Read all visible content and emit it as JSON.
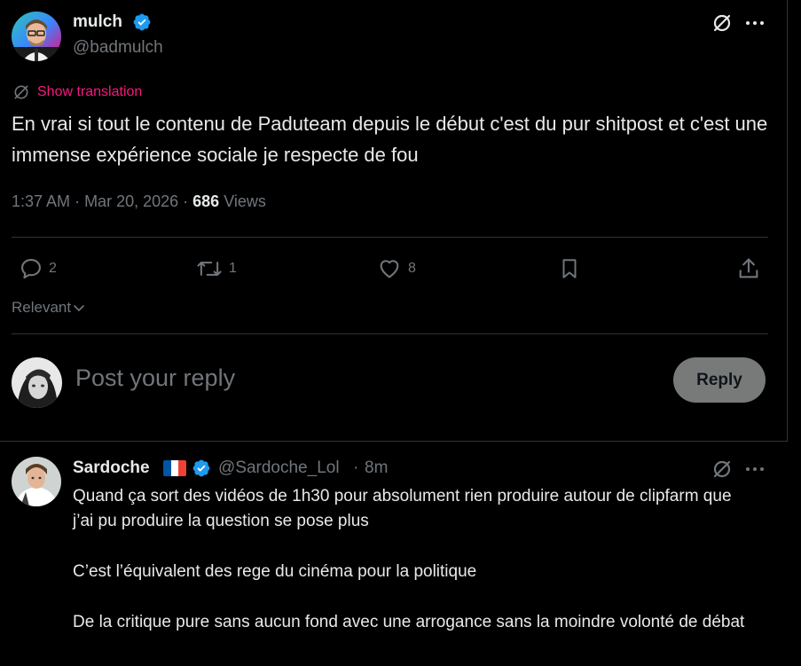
{
  "main_tweet": {
    "author": {
      "display_name": "mulch",
      "handle": "@badmulch"
    },
    "show_translation": "Show translation",
    "text": "En vrai si tout le contenu de Paduteam depuis le début c'est du pur shitpost et c'est une immense expérience sociale je respecte de fou",
    "time": "1:37 AM",
    "date": "Mar 20, 2026",
    "views_count": "686",
    "views_label": "Views",
    "actions": {
      "replies": "2",
      "reposts": "1",
      "likes": "8"
    }
  },
  "sort": {
    "label": "Relevant"
  },
  "composer": {
    "placeholder": "Post your reply",
    "reply_button": "Reply"
  },
  "reply": {
    "author": {
      "display_name": "Sardoche",
      "handle": "@Sardoche_Lol",
      "time": "8m"
    },
    "paragraphs": [
      "Quand ça sort des vidéos de 1h30 pour absolument rien produire autour de clipfarm que j’ai pu produire la question se pose plus",
      "C’est l’équivalent des rege du cinéma pour la politique",
      "De la critique pure sans aucun fond avec une arrogance sans la moindre volonté de débat"
    ]
  },
  "colors": {
    "verified": "#1d9bf0",
    "translation": "#f91880",
    "reply_button_bg": "#787a7a",
    "divider": "#2f3336"
  }
}
